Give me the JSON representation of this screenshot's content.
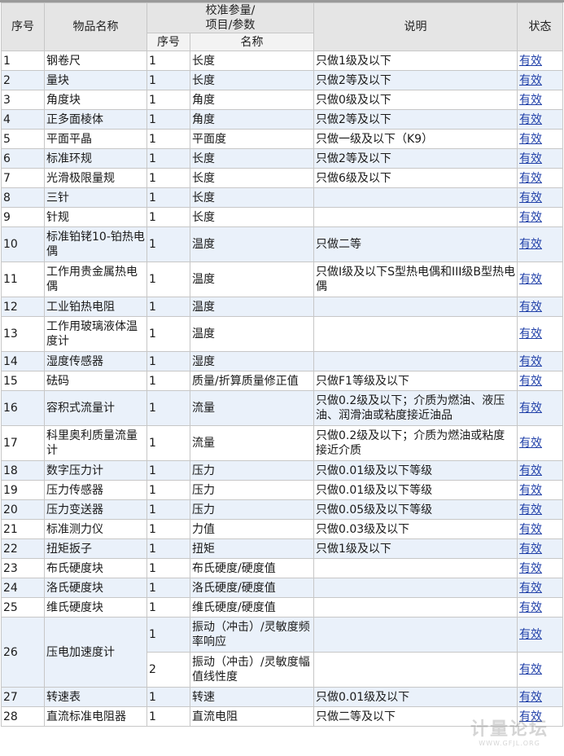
{
  "header": {
    "col_index": "序号",
    "col_name": "物品名称",
    "col_params": "校准参量/\n项目/参数",
    "col_desc": "说明",
    "col_status": "状态",
    "sub_index": "序号",
    "sub_name": "名称"
  },
  "rows": [
    {
      "no": "1",
      "item": "钢卷尺",
      "params": [
        {
          "idx": "1",
          "name": "长度"
        }
      ],
      "desc": "只做1级及以下",
      "status": "有效"
    },
    {
      "no": "2",
      "item": "量块",
      "params": [
        {
          "idx": "1",
          "name": "长度"
        }
      ],
      "desc": "只做2等及以下",
      "status": "有效"
    },
    {
      "no": "3",
      "item": "角度块",
      "params": [
        {
          "idx": "1",
          "name": "角度"
        }
      ],
      "desc": "只做0级及以下",
      "status": "有效"
    },
    {
      "no": "4",
      "item": "正多面棱体",
      "params": [
        {
          "idx": "1",
          "name": "角度"
        }
      ],
      "desc": "只做2等及以下",
      "status": "有效"
    },
    {
      "no": "5",
      "item": "平面平晶",
      "params": [
        {
          "idx": "1",
          "name": "平面度"
        }
      ],
      "desc": "只做一级及以下（K9）",
      "status": "有效"
    },
    {
      "no": "6",
      "item": "标准环规",
      "params": [
        {
          "idx": "1",
          "name": "长度"
        }
      ],
      "desc": "只做2等及以下",
      "status": "有效"
    },
    {
      "no": "7",
      "item": "光滑极限量规",
      "params": [
        {
          "idx": "1",
          "name": "长度"
        }
      ],
      "desc": "只做6级及以下",
      "status": "有效"
    },
    {
      "no": "8",
      "item": "三针",
      "params": [
        {
          "idx": "1",
          "name": "长度"
        }
      ],
      "desc": "",
      "status": "有效"
    },
    {
      "no": "9",
      "item": "针规",
      "params": [
        {
          "idx": "1",
          "name": "长度"
        }
      ],
      "desc": "",
      "status": "有效"
    },
    {
      "no": "10",
      "item": "标准铂铑10-铂热电偶",
      "params": [
        {
          "idx": "1",
          "name": "温度"
        }
      ],
      "desc": "只做二等",
      "status": "有效",
      "tall": true
    },
    {
      "no": "11",
      "item": "工作用贵金属热电偶",
      "params": [
        {
          "idx": "1",
          "name": "温度"
        }
      ],
      "desc": "只做Ⅰ级及以下S型热电偶和III级B型热电偶",
      "status": "有效",
      "tall": true
    },
    {
      "no": "12",
      "item": "工业铂热电阻",
      "params": [
        {
          "idx": "1",
          "name": "温度"
        }
      ],
      "desc": "",
      "status": "有效"
    },
    {
      "no": "13",
      "item": "工作用玻璃液体温度计",
      "params": [
        {
          "idx": "1",
          "name": "温度"
        }
      ],
      "desc": "",
      "status": "有效",
      "tall": true
    },
    {
      "no": "14",
      "item": "湿度传感器",
      "params": [
        {
          "idx": "1",
          "name": "湿度"
        }
      ],
      "desc": "",
      "status": "有效"
    },
    {
      "no": "15",
      "item": "砝码",
      "params": [
        {
          "idx": "1",
          "name": "质量/折算质量修正值"
        }
      ],
      "desc": "只做F1等级及以下",
      "status": "有效"
    },
    {
      "no": "16",
      "item": "容积式流量计",
      "params": [
        {
          "idx": "1",
          "name": "流量"
        }
      ],
      "desc": "只做0.2级及以下；介质为燃油、液压油、润滑油或粘度接近油品",
      "status": "有效",
      "tall": true
    },
    {
      "no": "17",
      "item": "科里奥利质量流量计",
      "params": [
        {
          "idx": "1",
          "name": "流量"
        }
      ],
      "desc": "只做0.2级及以下；介质为燃油或粘度接近介质",
      "status": "有效",
      "tall": true
    },
    {
      "no": "18",
      "item": "数字压力计",
      "params": [
        {
          "idx": "1",
          "name": "压力"
        }
      ],
      "desc": "只做0.01级及以下等级",
      "status": "有效"
    },
    {
      "no": "19",
      "item": "压力传感器",
      "params": [
        {
          "idx": "1",
          "name": "压力"
        }
      ],
      "desc": "只做0.01级及以下等级",
      "status": "有效"
    },
    {
      "no": "20",
      "item": "压力变送器",
      "params": [
        {
          "idx": "1",
          "name": "压力"
        }
      ],
      "desc": "只做0.05级及以下等级",
      "status": "有效"
    },
    {
      "no": "21",
      "item": "标准测力仪",
      "params": [
        {
          "idx": "1",
          "name": "力值"
        }
      ],
      "desc": "只做0.03级及以下",
      "status": "有效"
    },
    {
      "no": "22",
      "item": "扭矩扳子",
      "params": [
        {
          "idx": "1",
          "name": "扭矩"
        }
      ],
      "desc": "只做1级及以下",
      "status": "有效"
    },
    {
      "no": "23",
      "item": "布氏硬度块",
      "params": [
        {
          "idx": "1",
          "name": "布氏硬度/硬度值"
        }
      ],
      "desc": "",
      "status": "有效"
    },
    {
      "no": "24",
      "item": "洛氏硬度块",
      "params": [
        {
          "idx": "1",
          "name": "洛氏硬度/硬度值"
        }
      ],
      "desc": "",
      "status": "有效"
    },
    {
      "no": "25",
      "item": "维氏硬度块",
      "params": [
        {
          "idx": "1",
          "name": "维氏硬度/硬度值"
        }
      ],
      "desc": "",
      "status": "有效"
    },
    {
      "no": "26",
      "item": "压电加速度计",
      "params": [
        {
          "idx": "1",
          "name": "振动（冲击）/灵敏度频率响应",
          "desc": "",
          "status": "有效"
        },
        {
          "idx": "2",
          "name": "振动（冲击）/灵敏度幅值线性度",
          "desc": "",
          "status": "有效"
        }
      ],
      "tall": true
    },
    {
      "no": "27",
      "item": "转速表",
      "params": [
        {
          "idx": "1",
          "name": "转速"
        }
      ],
      "desc": "只做0.01级及以下",
      "status": "有效"
    },
    {
      "no": "28",
      "item": "直流标准电阻器",
      "params": [
        {
          "idx": "1",
          "name": "直流电阻"
        }
      ],
      "desc": "只做二等及以下",
      "status": "有效"
    }
  ],
  "watermark": {
    "line1": "计量论坛",
    "line2": "WWW.GFJL.ORG"
  }
}
